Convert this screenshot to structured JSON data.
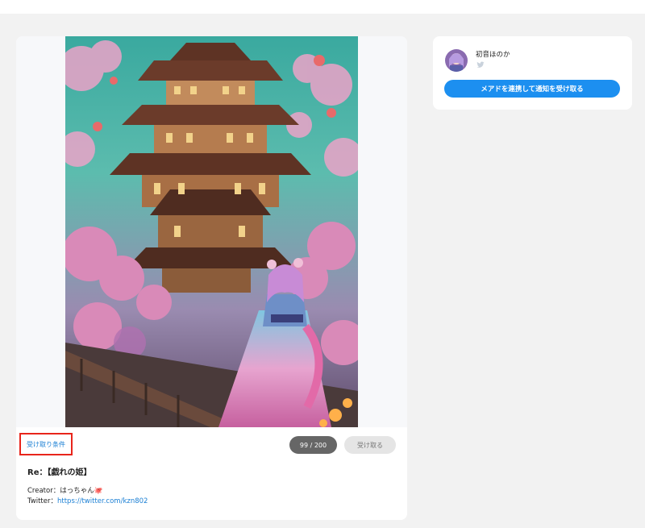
{
  "post": {
    "conditions_link": "受け取り条件",
    "claim_count": "99 / 200",
    "claim_button": "受け取る",
    "title": "Re：【戯れの姫】",
    "creator_line": "Creator：はっちゃん🐙",
    "twitter_prefix": "Twitter：",
    "twitter_url": "https://twitter.com/kzn802"
  },
  "sidebar": {
    "creator_name": "初音ほのか",
    "connect_button": "メアドを連携して通知を受け取る"
  },
  "colors": {
    "accent": "#1c8ff0",
    "link": "#1a7fd4",
    "highlight_border": "#e8251b",
    "count_pill": "#666666"
  },
  "icons": {
    "twitter": "bird-icon"
  }
}
